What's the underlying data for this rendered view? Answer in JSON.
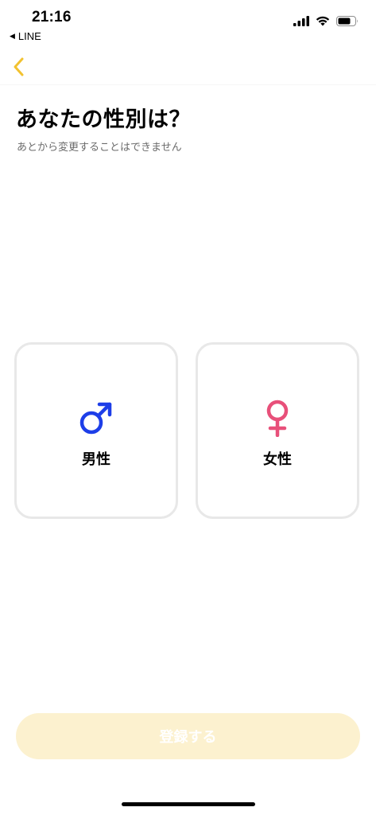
{
  "status_bar": {
    "time": "21:16",
    "back_app": "LINE",
    "back_glyph": "◀"
  },
  "nav": {
    "back_icon": "chevron-left-icon",
    "accent_color": "#f2c230"
  },
  "header": {
    "title": "あなたの性別は？",
    "subtitle": "あとから変更することはできません"
  },
  "options": [
    {
      "label": "男性",
      "icon": "male-symbol-icon",
      "color": "#1d3ee8"
    },
    {
      "label": "女性",
      "icon": "female-symbol-icon",
      "color": "#e8507a"
    }
  ],
  "register_button": {
    "label": "登録する",
    "enabled": false,
    "background": "#fcf1cf"
  }
}
